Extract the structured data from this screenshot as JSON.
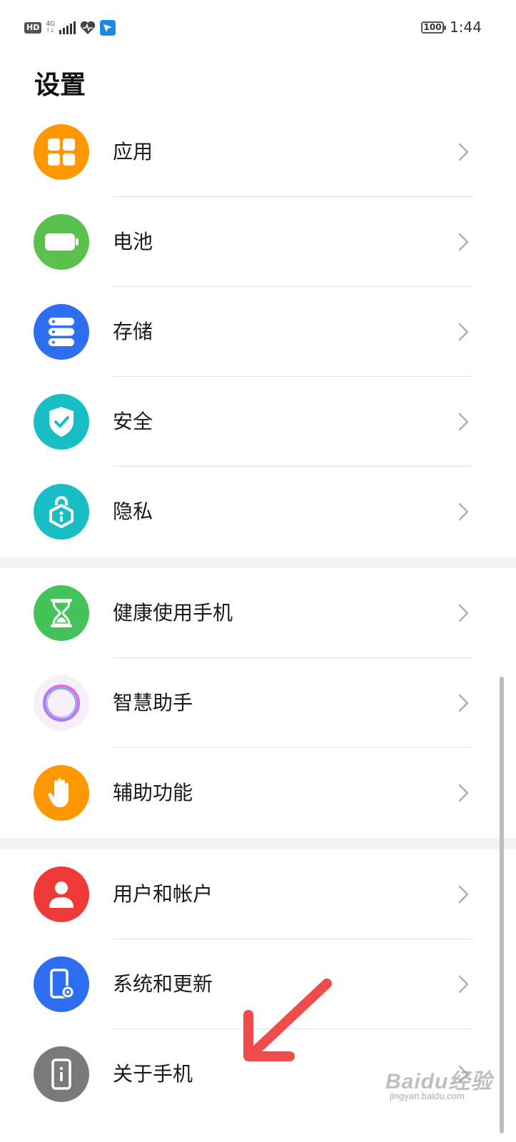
{
  "status_bar": {
    "hd": "HD",
    "network": "4G",
    "battery": "100",
    "time": "1:44"
  },
  "page": {
    "title": "设置"
  },
  "groups": [
    {
      "items": [
        {
          "label": "应用",
          "icon": "apps-icon",
          "color": "#ff9800"
        },
        {
          "label": "电池",
          "icon": "battery-icon",
          "color": "#5ac04e"
        },
        {
          "label": "存储",
          "icon": "storage-icon",
          "color": "#2d6ff0"
        },
        {
          "label": "安全",
          "icon": "shield-icon",
          "color": "#17bfc5"
        },
        {
          "label": "隐私",
          "icon": "privacy-lock-icon",
          "color": "#17bfc5"
        }
      ]
    },
    {
      "items": [
        {
          "label": "健康使用手机",
          "icon": "hourglass-icon",
          "color": "#43c35a"
        },
        {
          "label": "智慧助手",
          "icon": "assistant-ring-icon",
          "color": "#f6f0fa"
        },
        {
          "label": "辅助功能",
          "icon": "hand-icon",
          "color": "#ff9800"
        }
      ]
    },
    {
      "items": [
        {
          "label": "用户和帐户",
          "icon": "user-icon",
          "color": "#f03a3a"
        },
        {
          "label": "系统和更新",
          "icon": "system-update-icon",
          "color": "#2d6ff0"
        },
        {
          "label": "关于手机",
          "icon": "phone-info-icon",
          "color": "#7a7a7a"
        }
      ]
    }
  ],
  "watermark": {
    "brand": "Baidu经验",
    "site": "jingyan.baidu.com"
  }
}
